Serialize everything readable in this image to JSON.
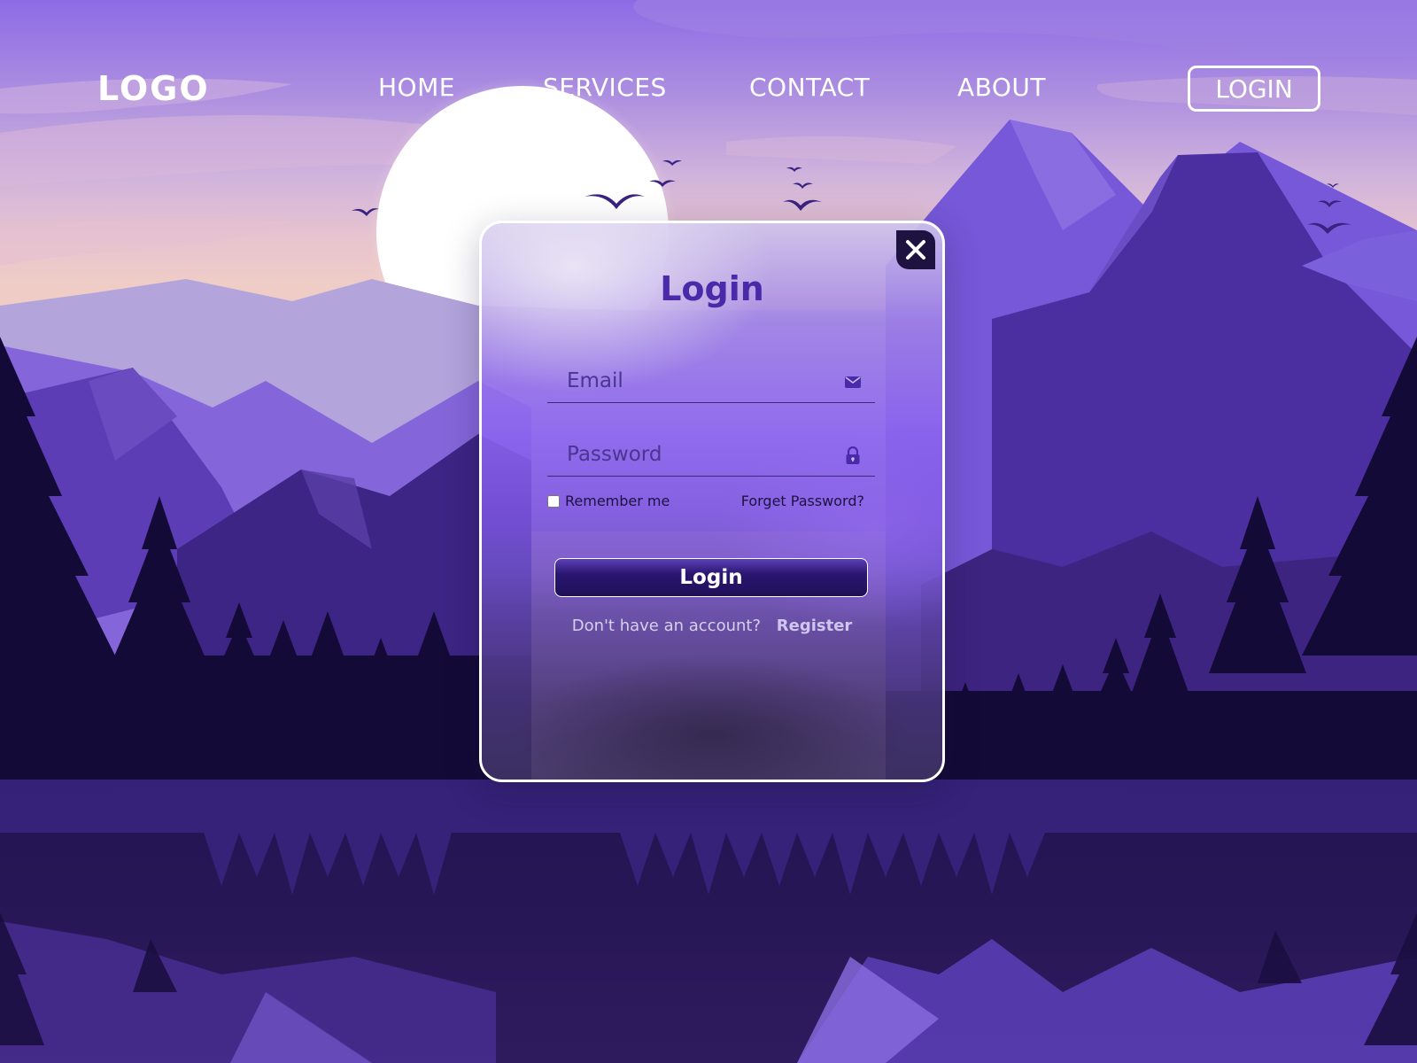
{
  "nav": {
    "logo": "LOGO",
    "links": [
      "HOME",
      "SERVICES",
      "CONTACT",
      "ABOUT"
    ],
    "login_button": "LOGIN"
  },
  "modal": {
    "title": "Login",
    "email_placeholder": "Email",
    "password_placeholder": "Password",
    "remember_label": "Remember me",
    "forget_label": "Forget Password?",
    "submit_label": "Login",
    "no_account_text": "Don't have an account?",
    "register_label": "Register"
  },
  "icons": {
    "close": "close-icon",
    "email": "envelope-icon",
    "password": "lock-icon"
  },
  "colors": {
    "accent": "#4a2aa8",
    "dark": "#1e1240",
    "sky_top": "#8f6ee8",
    "water": "#231552"
  }
}
